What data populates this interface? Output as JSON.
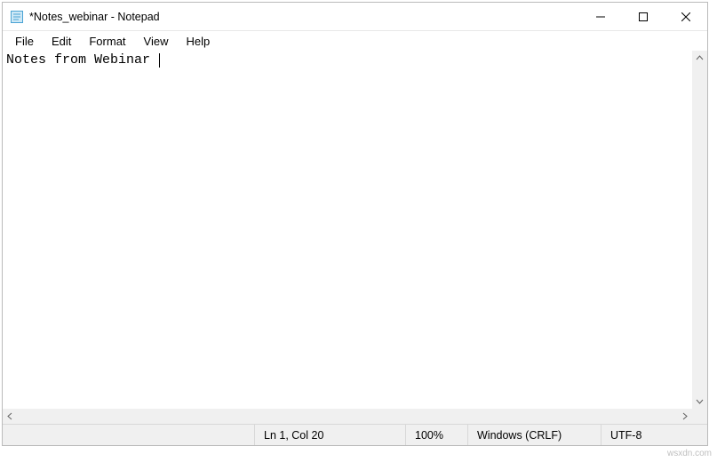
{
  "window": {
    "title": "*Notes_webinar - Notepad"
  },
  "menu": {
    "items": [
      "File",
      "Edit",
      "Format",
      "View",
      "Help"
    ]
  },
  "editor": {
    "content": "Notes from Webinar "
  },
  "status": {
    "lncol": "Ln 1, Col 20",
    "zoom": "100%",
    "eol": "Windows (CRLF)",
    "encoding": "UTF-8"
  },
  "watermark": "wsxdn.com"
}
